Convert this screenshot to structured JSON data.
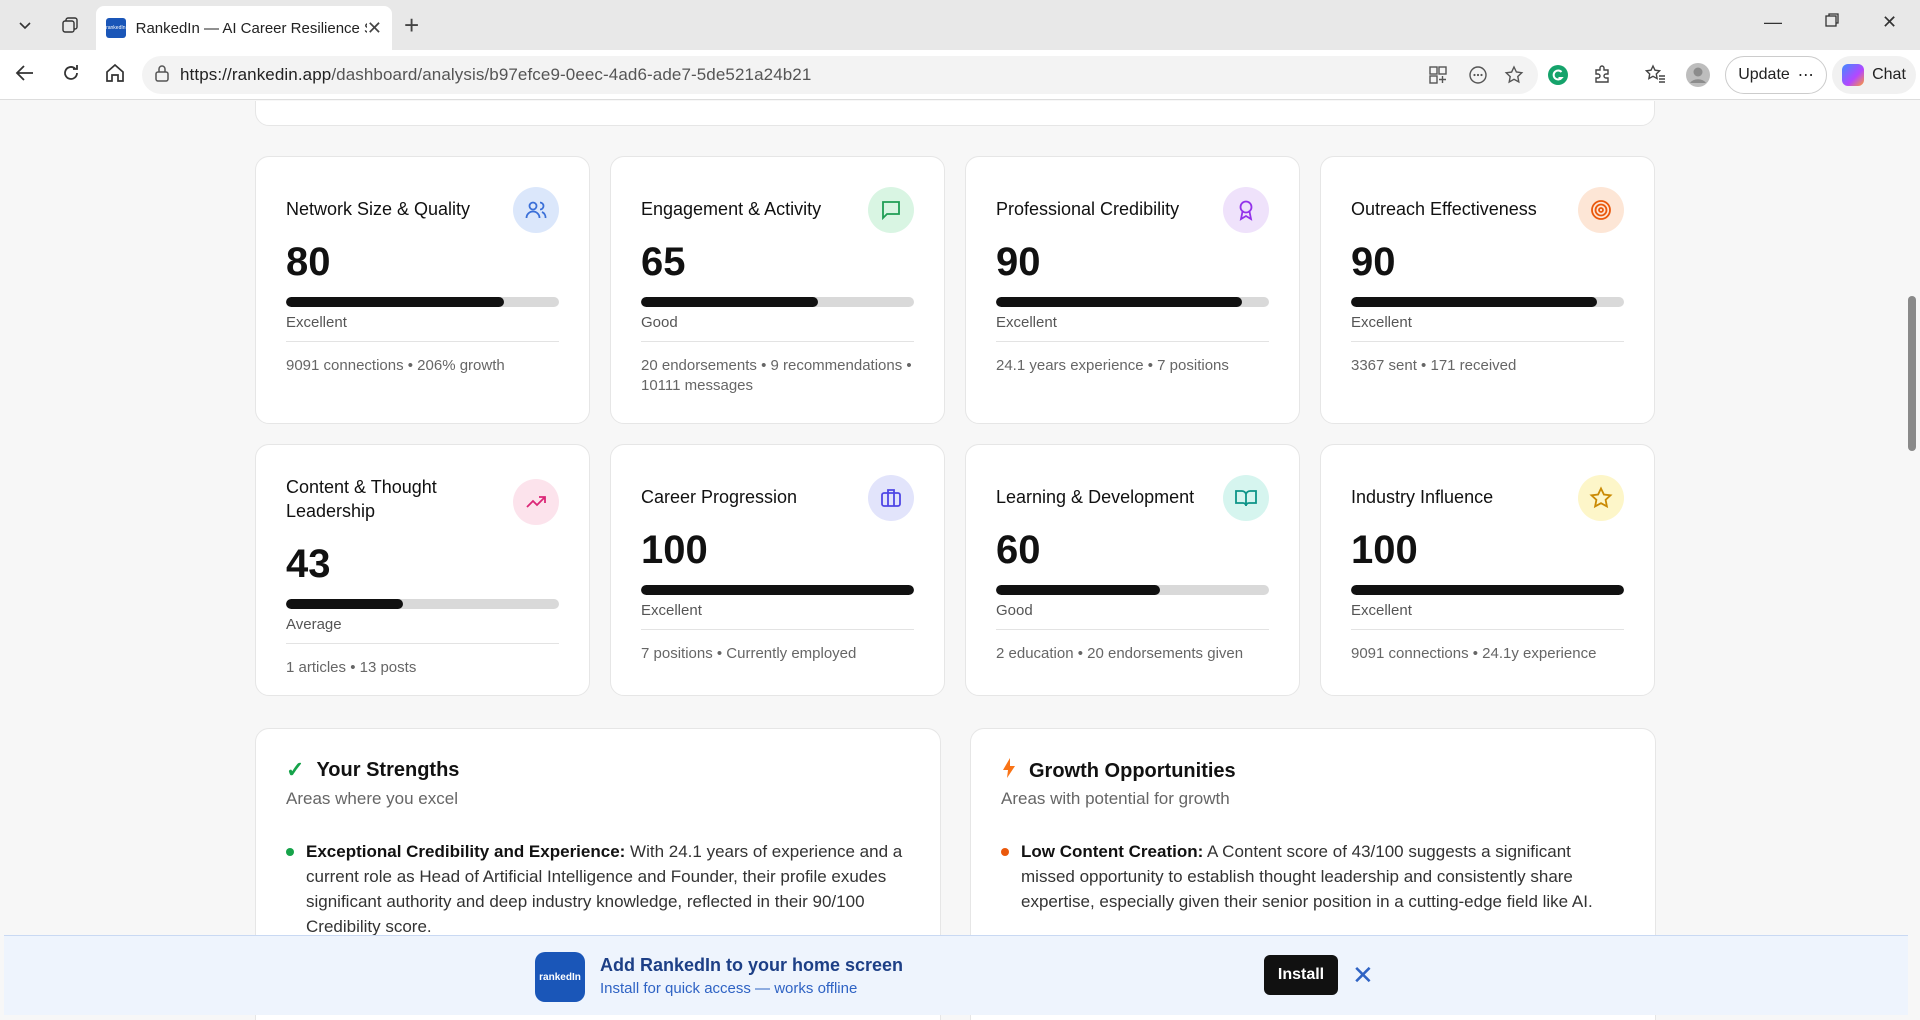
{
  "browser": {
    "tab_title": "RankedIn — AI Career Resilience S",
    "favicon_text": "rankedIn",
    "url_host": "https://rankedin.app",
    "url_path": "/dashboard/analysis/b97efce9-0eec-4ad6-ade7-5de521a24b21",
    "update_label": "Update",
    "chat_label": "Chat"
  },
  "metrics": [
    {
      "title": "Network Size & Quality",
      "score": "80",
      "fill": 0.8,
      "rating": "Excellent",
      "meta": "9091 connections • 206% growth",
      "icon": "users-icon",
      "icon_bg": "#dbe7fb",
      "icon_color": "#3a6fd8"
    },
    {
      "title": "Engagement & Activity",
      "score": "65",
      "fill": 0.65,
      "rating": "Good",
      "meta": "20 endorsements • 9 recommendations • 10111 messages",
      "icon": "message-icon",
      "icon_bg": "#d9f5e3",
      "icon_color": "#1f9d55"
    },
    {
      "title": "Professional Credibility",
      "score": "90",
      "fill": 0.9,
      "rating": "Excellent",
      "meta": "24.1 years experience • 7 positions",
      "icon": "award-icon",
      "icon_bg": "#efe2fb",
      "icon_color": "#9333ea"
    },
    {
      "title": "Outreach Effectiveness",
      "score": "90",
      "fill": 0.9,
      "rating": "Excellent",
      "meta": "3367 sent • 171 received",
      "icon": "target-icon",
      "icon_bg": "#fde6d6",
      "icon_color": "#ea580c"
    },
    {
      "title": "Content & Thought Leadership",
      "score": "43",
      "fill": 0.43,
      "rating": "Average",
      "meta": "1 articles • 13 posts",
      "icon": "trending-up-icon",
      "icon_bg": "#fce3ec",
      "icon_color": "#db2777"
    },
    {
      "title": "Career Progression",
      "score": "100",
      "fill": 1.0,
      "rating": "Excellent",
      "meta": "7 positions • Currently employed",
      "icon": "briefcase-icon",
      "icon_bg": "#e2e4fb",
      "icon_color": "#4f46e5"
    },
    {
      "title": "Learning & Development",
      "score": "60",
      "fill": 0.6,
      "rating": "Good",
      "meta": "2 education • 20 endorsements given",
      "icon": "book-icon",
      "icon_bg": "#d6f5ef",
      "icon_color": "#0d9488"
    },
    {
      "title": "Industry Influence",
      "score": "100",
      "fill": 1.0,
      "rating": "Excellent",
      "meta": "9091 connections • 24.1y experience",
      "icon": "star-icon",
      "icon_bg": "#fdf6c9",
      "icon_color": "#ca8a04"
    }
  ],
  "strengths": {
    "title": "Your Strengths",
    "subtitle": "Areas where you excel",
    "item_bold": "Exceptional Credibility and Experience:",
    "item_text": " With 24.1 years of experience and a current role as Head of Artificial Intelligence and Founder, their profile exudes significant authority and deep industry knowledge, reflected in their 90/100 Credibility score."
  },
  "growth": {
    "title": "Growth Opportunities",
    "subtitle": "Areas with potential for growth",
    "item_bold": "Low Content Creation:",
    "item_text": " A Content score of 43/100 suggests a significant missed opportunity to establish thought leadership and consistently share expertise, especially given their senior position in a cutting-edge field like AI."
  },
  "install_banner": {
    "logo_text": "rankedIn",
    "title": "Add RankedIn to your home screen",
    "subtitle": "Install for quick access — works offline",
    "button": "Install"
  }
}
